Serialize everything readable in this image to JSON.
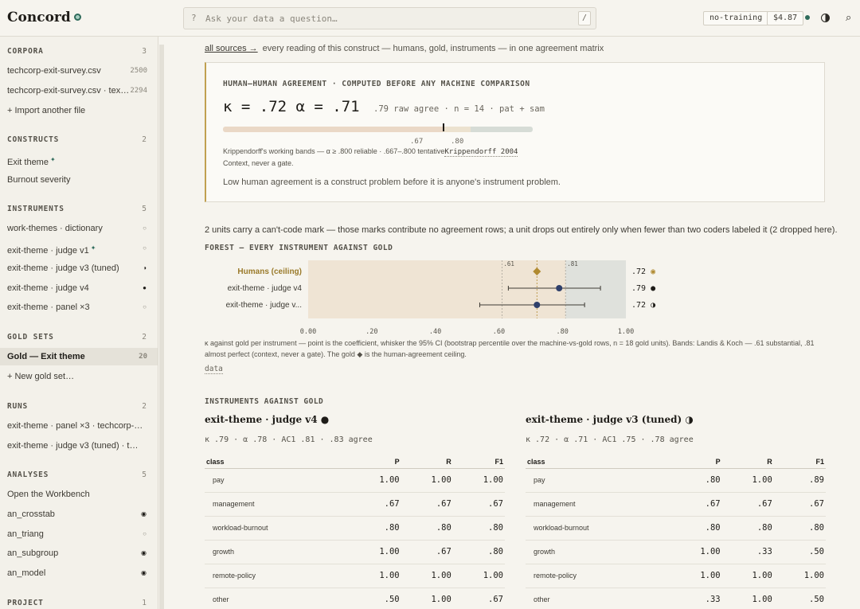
{
  "app": {
    "title": "Concord",
    "search_placeholder": "Ask your data a question…",
    "search_hint": "?",
    "search_kbd": "/",
    "mode_pill": "no-training",
    "cost_pill": "$4.87"
  },
  "sidebar": {
    "corpora": {
      "title": "CORPORA",
      "count": "3",
      "items": [
        {
          "label": "techcorp-exit-survey.csv",
          "meta": "2500"
        },
        {
          "label": "techcorp-exit-survey.csv · tex…",
          "meta": "2294"
        },
        {
          "label": "+ Import another file",
          "meta": ""
        }
      ]
    },
    "constructs": {
      "title": "CONSTRUCTS",
      "count": "2",
      "items": [
        {
          "label": "Exit theme"
        },
        {
          "label": "Burnout severity"
        }
      ]
    },
    "instruments": {
      "title": "INSTRUMENTS",
      "count": "5",
      "items": [
        {
          "label": "work-themes · dictionary"
        },
        {
          "label": "exit-theme · judge v1"
        },
        {
          "label": "exit-theme · judge v3 (tuned)"
        },
        {
          "label": "exit-theme · judge v4"
        },
        {
          "label": "exit-theme · panel ×3"
        }
      ]
    },
    "gold_sets": {
      "title": "GOLD SETS",
      "count": "2",
      "items": [
        {
          "label": "Gold — Exit theme",
          "meta": "20"
        },
        {
          "label": "+ New gold set…",
          "meta": ""
        }
      ]
    },
    "runs": {
      "title": "RUNS",
      "count": "2",
      "items": [
        {
          "label": "exit-theme · panel ×3 · techcorp-…"
        },
        {
          "label": "exit-theme · judge v3 (tuned) · t…"
        }
      ]
    },
    "analyses": {
      "title": "ANALYSES",
      "count": "5",
      "items": [
        {
          "label": "Open the Workbench"
        },
        {
          "label": "an_crosstab"
        },
        {
          "label": "an_triang"
        },
        {
          "label": "an_subgroup"
        },
        {
          "label": "an_model"
        }
      ]
    },
    "project": {
      "title": "PROJECT",
      "count": "1"
    }
  },
  "main": {
    "breadcrumb_link": "all sources →",
    "breadcrumb_text": "every reading of this construct — humans, gold, instruments — in one agreement matrix",
    "agreement": {
      "eyebrow": "HUMAN–HUMAN AGREEMENT · COMPUTED BEFORE ANY MACHINE COMPARISON",
      "headline": "κ = .72 α = .71",
      "sub": ".79 raw agree · n = 14 · pat + sam",
      "tick_a": ".67",
      "tick_b": ".80",
      "note": "Krippendorff's working bands — α ≥ .800 reliable · .667–.800 tentative",
      "cite": "Krippendorff 2004",
      "note2": "Context, never a gate.",
      "footer": "Low human agreement is a construct problem before it is anyone's instrument problem."
    },
    "units_line": "2 units carry a can't-code mark — those marks contribute no agreement rows; a unit drops out entirely only when fewer than two coders labeled it (2 dropped here).",
    "forest": {
      "title": "FOREST — EVERY INSTRUMENT AGAINST GOLD",
      "ref_a": ".61",
      "ref_b": ".81",
      "axis_ticks": [
        "0.00",
        ".20",
        ".40",
        ".60",
        ".80",
        "1.00"
      ],
      "caption": "κ against gold per instrument — point is the coefficient, whisker the 95% CI (bootstrap percentile over the machine-vs-gold rows, n = 18 gold units). Bands: Landis & Koch — .61 substantial, .81 almost perfect (context, never a gate). The gold ◆ is the human-agreement ceiling.",
      "data_link": "data"
    },
    "instruments_title": "INSTRUMENTS AGAINST GOLD",
    "table_headers": {
      "cls": "class",
      "p": "P",
      "r": "R",
      "f1": "F1"
    },
    "instrument_a": {
      "title": "exit-theme · judge v4 ●",
      "stats": "κ .79 · α .78 · AC1 .81 · .83 agree",
      "rows": [
        {
          "cls": "pay",
          "p": "1.00",
          "r": "1.00",
          "f1": "1.00"
        },
        {
          "cls": "management",
          "p": ".67",
          "r": ".67",
          "f1": ".67"
        },
        {
          "cls": "workload-burnout",
          "p": ".80",
          "r": ".80",
          "f1": ".80"
        },
        {
          "cls": "growth",
          "p": "1.00",
          "r": ".67",
          "f1": ".80"
        },
        {
          "cls": "remote-policy",
          "p": "1.00",
          "r": "1.00",
          "f1": "1.00"
        },
        {
          "cls": "other",
          "p": ".50",
          "r": "1.00",
          "f1": ".67"
        }
      ]
    },
    "instrument_b": {
      "title": "exit-theme · judge v3 (tuned) ◑",
      "stats": "κ .72 · α .71 · AC1 .75 · .78 agree",
      "rows": [
        {
          "cls": "pay",
          "p": ".80",
          "r": "1.00",
          "f1": ".89"
        },
        {
          "cls": "management",
          "p": ".67",
          "r": ".67",
          "f1": ".67"
        },
        {
          "cls": "workload-burnout",
          "p": ".80",
          "r": ".80",
          "f1": ".80"
        },
        {
          "cls": "growth",
          "p": "1.00",
          "r": ".33",
          "f1": ".50"
        },
        {
          "cls": "remote-policy",
          "p": "1.00",
          "r": "1.00",
          "f1": "1.00"
        },
        {
          "cls": "other",
          "p": ".33",
          "r": "1.00",
          "f1": ".50"
        }
      ]
    }
  },
  "chart_data": {
    "type": "scatter",
    "title": "FOREST — EVERY INSTRUMENT AGAINST GOLD",
    "xlim": [
      0,
      1
    ],
    "xticks": [
      "0.00",
      ".20",
      ".40",
      ".60",
      ".80",
      "1.00"
    ],
    "reference_lines": [
      0.61,
      0.81
    ],
    "bands": [
      {
        "from": 0,
        "to": 0.81,
        "color": "#efe4d4"
      },
      {
        "from": 0.81,
        "to": 1.0,
        "color": "#dfe1dc"
      }
    ],
    "series": [
      {
        "name": "Humans (ceiling)",
        "value": 0.72,
        "value_label": ".72",
        "marker": "diamond",
        "color": "#b08a30"
      },
      {
        "name": "exit-theme · judge v4",
        "value": 0.79,
        "ci": [
          0.63,
          0.92
        ],
        "value_label": ".79",
        "marker": "circle",
        "color": "#2e3f6b"
      },
      {
        "name": "exit-theme · judge v...",
        "value": 0.72,
        "ci": [
          0.54,
          0.87
        ],
        "value_label": ".72",
        "marker": "circle",
        "color": "#2e3f6b"
      }
    ]
  }
}
